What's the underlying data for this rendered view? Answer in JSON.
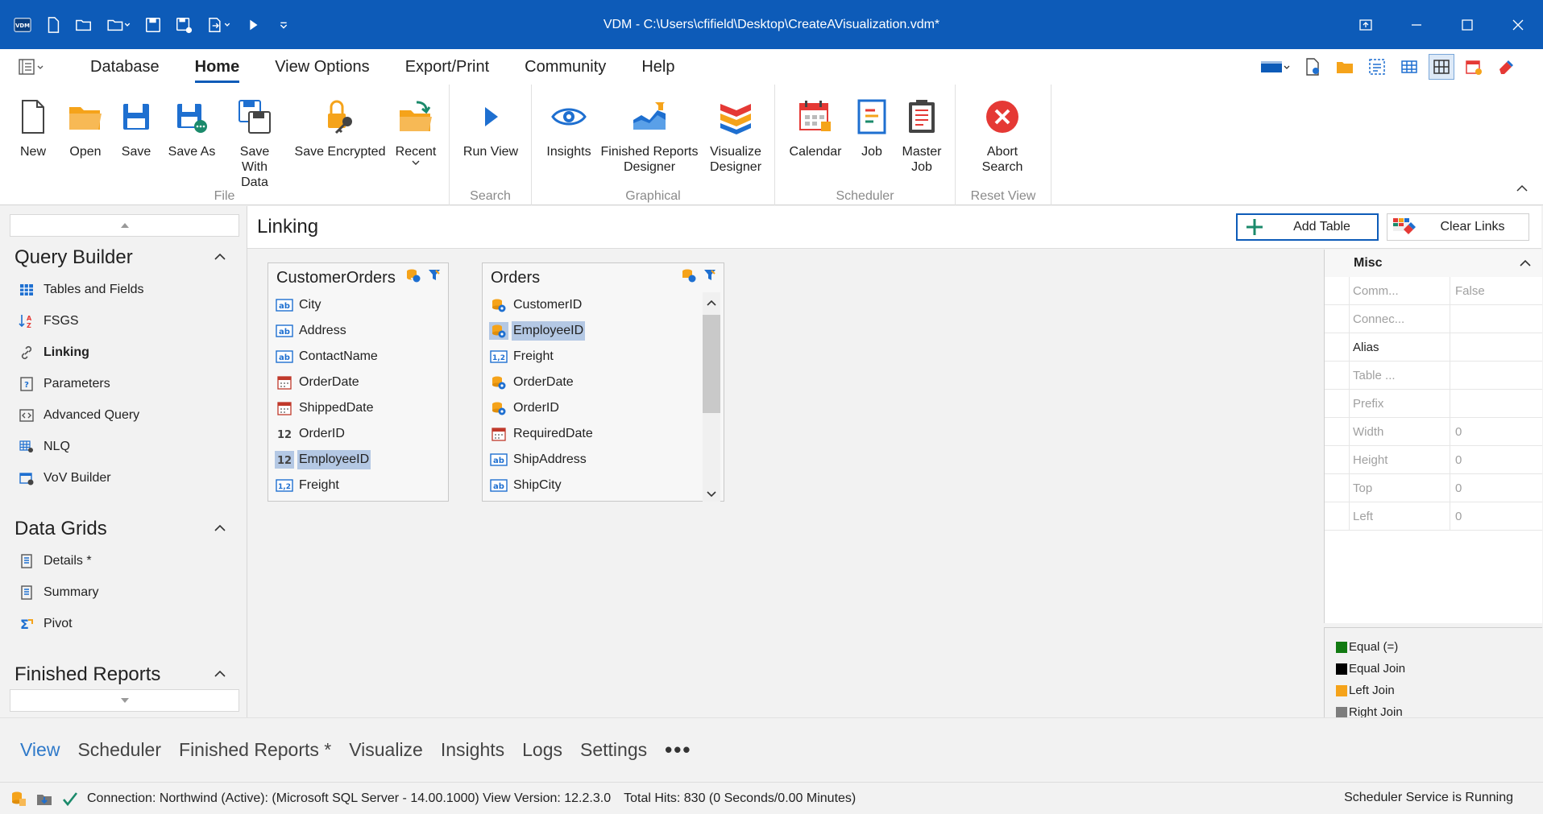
{
  "window": {
    "title": "VDM - C:\\Users\\cfifield\\Desktop\\CreateAVisualization.vdm*",
    "logo_text": "VDM"
  },
  "menubar": {
    "tabs": [
      "Database",
      "Home",
      "View Options",
      "Export/Print",
      "Community",
      "Help"
    ],
    "active_tab": "Home"
  },
  "ribbon": {
    "groups": {
      "file": "File",
      "search": "Search",
      "graphical": "Graphical",
      "scheduler": "Scheduler",
      "reset_view": "Reset View"
    },
    "buttons": {
      "new": "New",
      "open": "Open",
      "save": "Save",
      "save_as": "Save As",
      "save_with_data": "Save With Data",
      "save_encrypted": "Save Encrypted",
      "recent": "Recent",
      "run_view": "Run View",
      "insights": "Insights",
      "finished_reports_designer": "Finished Reports Designer",
      "visualize_designer": "Visualize Designer",
      "calendar": "Calendar",
      "job": "Job",
      "master_job": "Master Job",
      "abort_search": "Abort Search"
    }
  },
  "leftnav": {
    "sections": [
      {
        "title": "Query Builder",
        "items": [
          {
            "label": "Tables and Fields",
            "icon": "grid-icon"
          },
          {
            "label": "FSGS",
            "icon": "sort-filter-icon"
          },
          {
            "label": "Linking",
            "icon": "link-icon",
            "active": true
          },
          {
            "label": "Parameters",
            "icon": "parameters-icon"
          },
          {
            "label": "Advanced Query",
            "icon": "code-icon"
          },
          {
            "label": "NLQ",
            "icon": "nlq-icon"
          },
          {
            "label": "VoV Builder",
            "icon": "vov-icon"
          }
        ]
      },
      {
        "title": "Data Grids",
        "items": [
          {
            "label": "Details *",
            "icon": "details-grid-icon"
          },
          {
            "label": "Summary",
            "icon": "summary-grid-icon"
          },
          {
            "label": "Pivot",
            "icon": "pivot-icon"
          }
        ]
      },
      {
        "title": "Finished Reports",
        "items": []
      }
    ]
  },
  "main": {
    "title": "Linking",
    "add_table_label": "Add Table",
    "clear_links_label": "Clear Links",
    "tables": [
      {
        "name": "CustomerOrders",
        "fields": [
          {
            "label": "City",
            "type": "text"
          },
          {
            "label": "Address",
            "type": "text"
          },
          {
            "label": "ContactName",
            "type": "text"
          },
          {
            "label": "OrderDate",
            "type": "date"
          },
          {
            "label": "ShippedDate",
            "type": "date"
          },
          {
            "label": "OrderID",
            "type": "int"
          },
          {
            "label": "EmployeeID",
            "type": "int",
            "selected": true
          },
          {
            "label": "Freight",
            "type": "decimal"
          }
        ]
      },
      {
        "name": "Orders",
        "fields": [
          {
            "label": "CustomerID",
            "type": "key"
          },
          {
            "label": "EmployeeID",
            "type": "key",
            "selected": true
          },
          {
            "label": "Freight",
            "type": "decimal"
          },
          {
            "label": "OrderDate",
            "type": "key"
          },
          {
            "label": "OrderID",
            "type": "key"
          },
          {
            "label": "RequiredDate",
            "type": "date"
          },
          {
            "label": "ShipAddress",
            "type": "text"
          },
          {
            "label": "ShipCity",
            "type": "text"
          }
        ]
      }
    ],
    "link": {
      "from": "CustomerOrders.EmployeeID",
      "to": "Orders.EmployeeID",
      "join_type": "Equal Join",
      "color": "#000000"
    }
  },
  "properties": {
    "section": "Misc",
    "rows": [
      {
        "name": "Comm...",
        "value": "False",
        "enabled": false
      },
      {
        "name": "Connec...",
        "value": "",
        "enabled": false
      },
      {
        "name": "Alias",
        "value": "",
        "enabled": true
      },
      {
        "name": "Table ...",
        "value": "",
        "enabled": false
      },
      {
        "name": "Prefix",
        "value": "",
        "enabled": false
      },
      {
        "name": "Width",
        "value": "0",
        "enabled": false
      },
      {
        "name": "Height",
        "value": "0",
        "enabled": false
      },
      {
        "name": "Top",
        "value": "0",
        "enabled": false
      },
      {
        "name": "Left",
        "value": "0",
        "enabled": false
      }
    ]
  },
  "legend": [
    {
      "label": "Equal (=)",
      "color": "#127a12"
    },
    {
      "label": "Equal Join",
      "color": "#000000"
    },
    {
      "label": "Left Join",
      "color": "#f5a31a"
    },
    {
      "label": "Right Join",
      "color": "#7d7d7d"
    }
  ],
  "bottom_tabs": {
    "tabs": [
      "View",
      "Scheduler",
      "Finished Reports *",
      "Visualize",
      "Insights",
      "Logs",
      "Settings"
    ],
    "active": "View",
    "more": "•••"
  },
  "statusbar": {
    "connection": "Connection: Northwind (Active): (Microsoft SQL Server - 14.00.1000) View Version: 12.2.3.0",
    "total_hits": "Total Hits: 830 (0 Seconds/0.00 Minutes)",
    "scheduler": "Scheduler Service is Running"
  },
  "colors": {
    "titlebar": "#0d5bb8",
    "selection": "#b4c8e4",
    "accent_orange": "#f5a31a",
    "accent_red": "#e53935"
  }
}
